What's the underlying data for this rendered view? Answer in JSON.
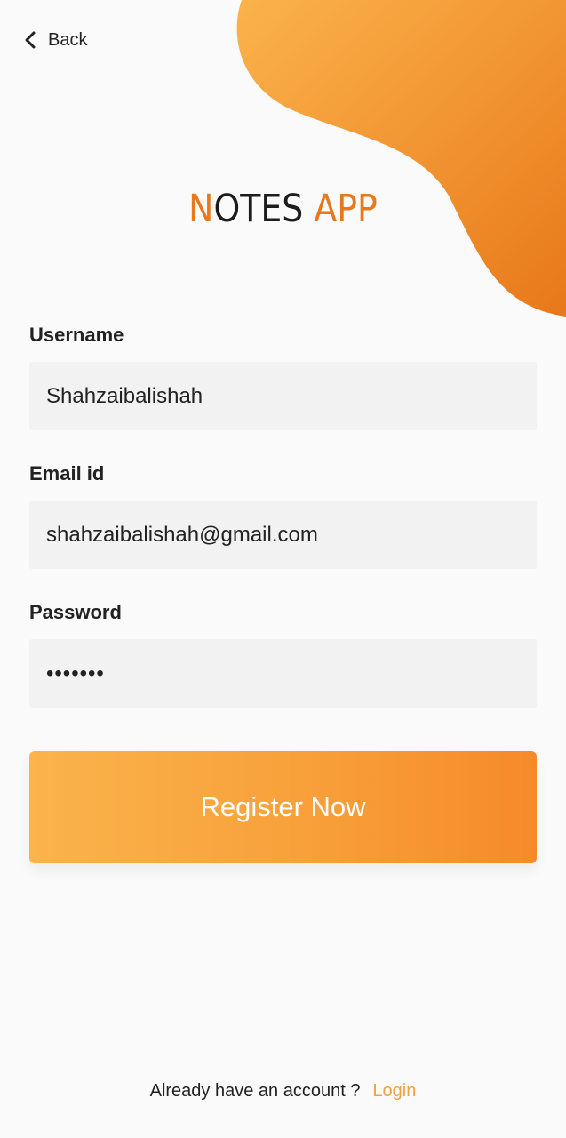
{
  "colors": {
    "accent": "#e8781a",
    "blob_start": "#fbb34b",
    "blob_end": "#e8781a",
    "button_start": "#fbb34b",
    "button_end": "#f68a2a",
    "link": "#f0a040",
    "background": "#fafafa",
    "field_bg": "#f2f2f2"
  },
  "header": {
    "back_icon": "chevron-left-icon",
    "back_label": "Back"
  },
  "app_title": {
    "first_letter": "N",
    "rest": "OTES",
    "accent_word": "APP"
  },
  "form": {
    "username": {
      "label": "Username",
      "value": "Shahzaibalishah"
    },
    "email": {
      "label": "Email id",
      "value": "shahzaibalishah@gmail.com"
    },
    "password": {
      "label": "Password",
      "value": "•••••••"
    },
    "submit_label": "Register Now"
  },
  "footer": {
    "prompt": "Already have an account ?",
    "login_label": "Login"
  }
}
